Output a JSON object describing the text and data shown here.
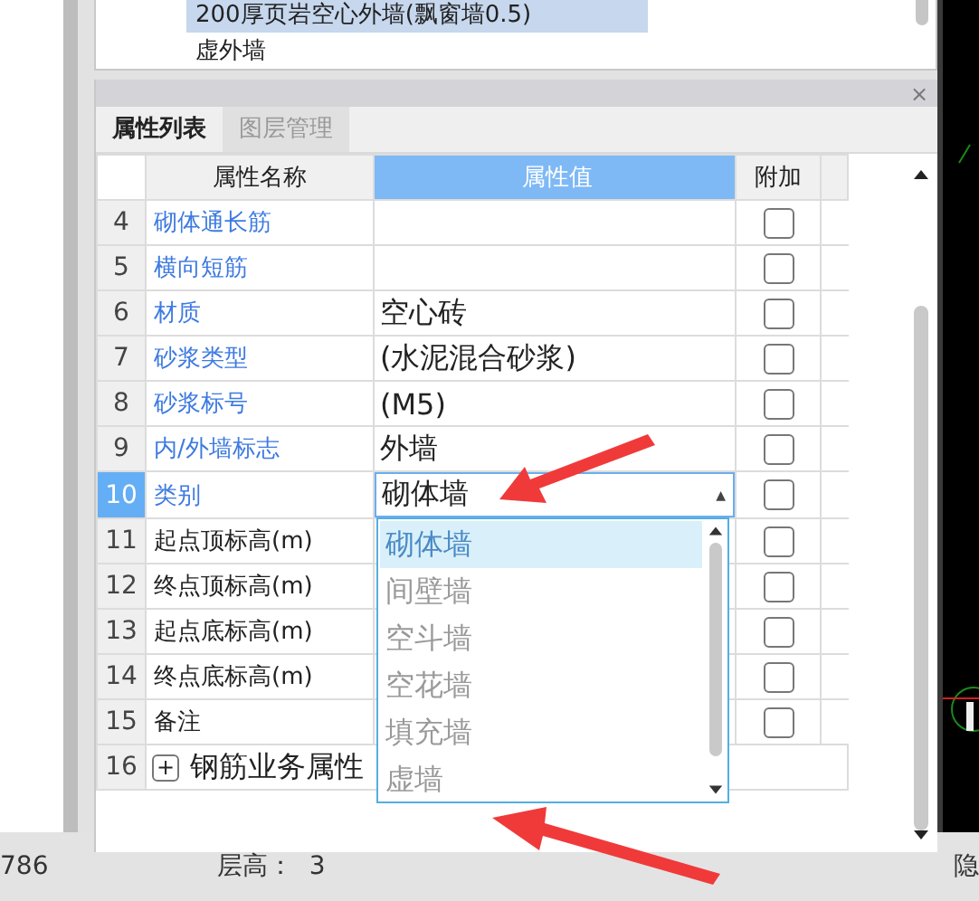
{
  "top_list": {
    "items": [
      {
        "label": "200厚页岩空心外墙(飘窗墙0.5)",
        "selected": true
      },
      {
        "label": "虚外墙",
        "selected": false
      }
    ]
  },
  "panel": {
    "close": "×",
    "tabs": [
      {
        "label": "属性列表",
        "selected": true
      },
      {
        "label": "图层管理",
        "selected": false
      }
    ],
    "columns": [
      "属性名称",
      "属性值",
      "附加"
    ],
    "rows": [
      {
        "number": "4",
        "name": "砌体通长筋",
        "kind": "field",
        "emphasized": true,
        "checked": false,
        "selected": false
      },
      {
        "number": "5",
        "name": "横向短筋",
        "kind": "field",
        "emphasized": true,
        "checked": false,
        "selected": false
      },
      {
        "number": "6",
        "name": "材质",
        "value": "空心砖",
        "kind": "field",
        "emphasized": true,
        "checked": false,
        "selected": false
      },
      {
        "number": "7",
        "name": "砂浆类型",
        "value": "(水泥混合砂浆)",
        "kind": "field",
        "emphasized": true,
        "checked": false,
        "selected": false
      },
      {
        "number": "8",
        "name": "砂浆标号",
        "value": "(M5)",
        "kind": "field",
        "emphasized": true,
        "checked": false,
        "selected": false
      },
      {
        "number": "9",
        "name": "内/外墙标志",
        "value": "外墙",
        "kind": "field",
        "emphasized": true,
        "checked": false,
        "selected": false
      },
      {
        "number": "10",
        "name": "类别",
        "value": "砌体墙",
        "kind": "combo",
        "caret": "▲",
        "emphasized": true,
        "checked": false,
        "selected": true,
        "dropdown": {
          "open": true,
          "options": [
            {
              "label": "砌体墙",
              "selected": true
            },
            {
              "label": "间壁墙",
              "selected": false
            },
            {
              "label": "空斗墙",
              "selected": false
            },
            {
              "label": "空花墙",
              "selected": false
            },
            {
              "label": "填充墙",
              "selected": false
            },
            {
              "label": "虚墙",
              "selected": false
            }
          ]
        }
      },
      {
        "number": "11",
        "name": "起点顶标高(m)",
        "kind": "field",
        "emphasized": false,
        "checked": false,
        "selected": false
      },
      {
        "number": "12",
        "name": "终点顶标高(m)",
        "kind": "field",
        "emphasized": false,
        "checked": false,
        "selected": false
      },
      {
        "number": "13",
        "name": "起点底标高(m)",
        "kind": "field",
        "emphasized": false,
        "checked": false,
        "selected": false
      },
      {
        "number": "14",
        "name": "终点底标高(m)",
        "kind": "field",
        "emphasized": false,
        "checked": false,
        "selected": false
      },
      {
        "number": "15",
        "name": "备注",
        "kind": "field",
        "emphasized": false,
        "checked": false,
        "selected": false
      },
      {
        "number": "16",
        "name": "钢筋业务属性",
        "kind": "group",
        "expand_sign": "+",
        "expanded": false,
        "selected": false
      }
    ]
  },
  "status_bar": {
    "items": [
      "786",
      "层高：  3",
      "隐"
    ]
  }
}
